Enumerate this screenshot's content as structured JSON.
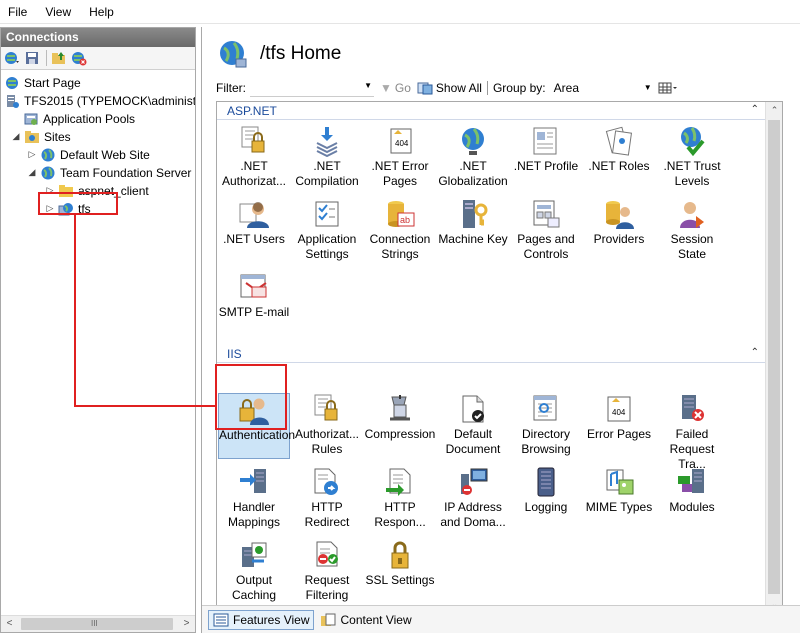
{
  "menu": [
    "File",
    "View",
    "Help"
  ],
  "connections": {
    "title": "Connections",
    "tree": [
      {
        "label": "Start Page"
      },
      {
        "label": "TFS2015 (TYPEMOCK\\administrat"
      },
      {
        "label": "Application Pools"
      },
      {
        "label": "Sites"
      },
      {
        "label": "Default Web Site"
      },
      {
        "label": "Team Foundation Server"
      },
      {
        "label": "aspnet_client"
      },
      {
        "label": "tfs"
      }
    ]
  },
  "page": {
    "title": "/tfs Home"
  },
  "filterbar": {
    "filter_label": "Filter:",
    "filter_value": "",
    "go_label": "Go",
    "show_all_label": "Show All",
    "group_by_label": "Group by:",
    "group_by_value": "Area"
  },
  "sections": {
    "aspnet": {
      "title": "ASP.NET",
      "items": [
        {
          "label": ".NET Authorizat...",
          "icon": "net-authorization-icon"
        },
        {
          "label": ".NET Compilation",
          "icon": "net-compilation-icon"
        },
        {
          "label": ".NET Error Pages",
          "icon": "net-error-pages-icon"
        },
        {
          "label": ".NET Globalization",
          "icon": "net-globalization-icon"
        },
        {
          "label": ".NET Profile",
          "icon": "net-profile-icon"
        },
        {
          "label": ".NET Roles",
          "icon": "net-roles-icon"
        },
        {
          "label": ".NET Trust Levels",
          "icon": "net-trust-levels-icon"
        },
        {
          "label": ".NET Users",
          "icon": "net-users-icon"
        },
        {
          "label": "Application Settings",
          "icon": "application-settings-icon"
        },
        {
          "label": "Connection Strings",
          "icon": "connection-strings-icon"
        },
        {
          "label": "Machine Key",
          "icon": "machine-key-icon"
        },
        {
          "label": "Pages and Controls",
          "icon": "pages-controls-icon"
        },
        {
          "label": "Providers",
          "icon": "providers-icon"
        },
        {
          "label": "Session State",
          "icon": "session-state-icon"
        },
        {
          "label": "SMTP E-mail",
          "icon": "smtp-email-icon"
        }
      ]
    },
    "iis": {
      "title": "IIS",
      "items": [
        {
          "label": "Authentication",
          "icon": "authentication-icon"
        },
        {
          "label": "Authorizat... Rules",
          "icon": "authorization-rules-icon"
        },
        {
          "label": "Compression",
          "icon": "compression-icon"
        },
        {
          "label": "Default Document",
          "icon": "default-document-icon"
        },
        {
          "label": "Directory Browsing",
          "icon": "directory-browsing-icon"
        },
        {
          "label": "Error Pages",
          "icon": "error-pages-icon"
        },
        {
          "label": "Failed Request Tra...",
          "icon": "failed-request-icon"
        },
        {
          "label": "Handler Mappings",
          "icon": "handler-mappings-icon"
        },
        {
          "label": "HTTP Redirect",
          "icon": "http-redirect-icon"
        },
        {
          "label": "HTTP Respon...",
          "icon": "http-response-icon"
        },
        {
          "label": "IP Address and Doma...",
          "icon": "ip-address-icon"
        },
        {
          "label": "Logging",
          "icon": "logging-icon"
        },
        {
          "label": "MIME Types",
          "icon": "mime-types-icon"
        },
        {
          "label": "Modules",
          "icon": "modules-icon"
        },
        {
          "label": "Output Caching",
          "icon": "output-caching-icon"
        },
        {
          "label": "Request Filtering",
          "icon": "request-filtering-icon"
        },
        {
          "label": "SSL Settings",
          "icon": "ssl-settings-icon"
        }
      ]
    }
  },
  "bottom_tabs": {
    "features_view": "Features View",
    "content_view": "Content View"
  },
  "scrollbar": {
    "grip": "III"
  },
  "colors": {
    "section_title": "#1b4b9b",
    "highlight": "#e02020",
    "selection": "#cce4f7"
  }
}
